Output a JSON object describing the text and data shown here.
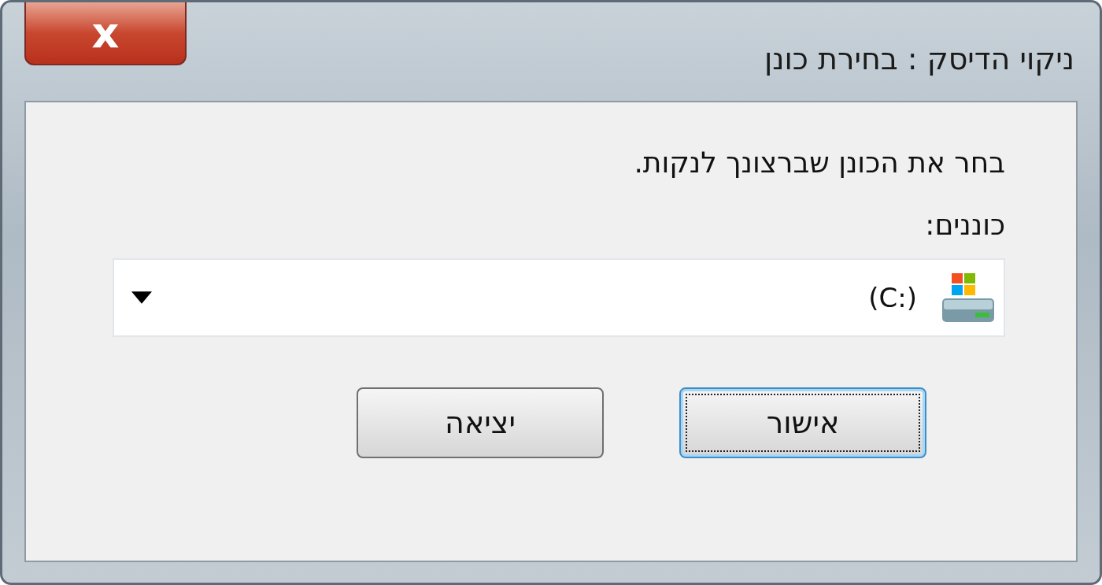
{
  "window": {
    "title": "ניקוי הדיסק : בחירת כונן",
    "close": "x"
  },
  "prompt": "בחר את הכונן שברצונך לנקות.",
  "drives_label": "כוננים:",
  "drive_select": {
    "value": "(C:)"
  },
  "buttons": [
    {
      "label": "אישור",
      "focused": true
    },
    {
      "label": "יציאה",
      "focused": false
    }
  ]
}
